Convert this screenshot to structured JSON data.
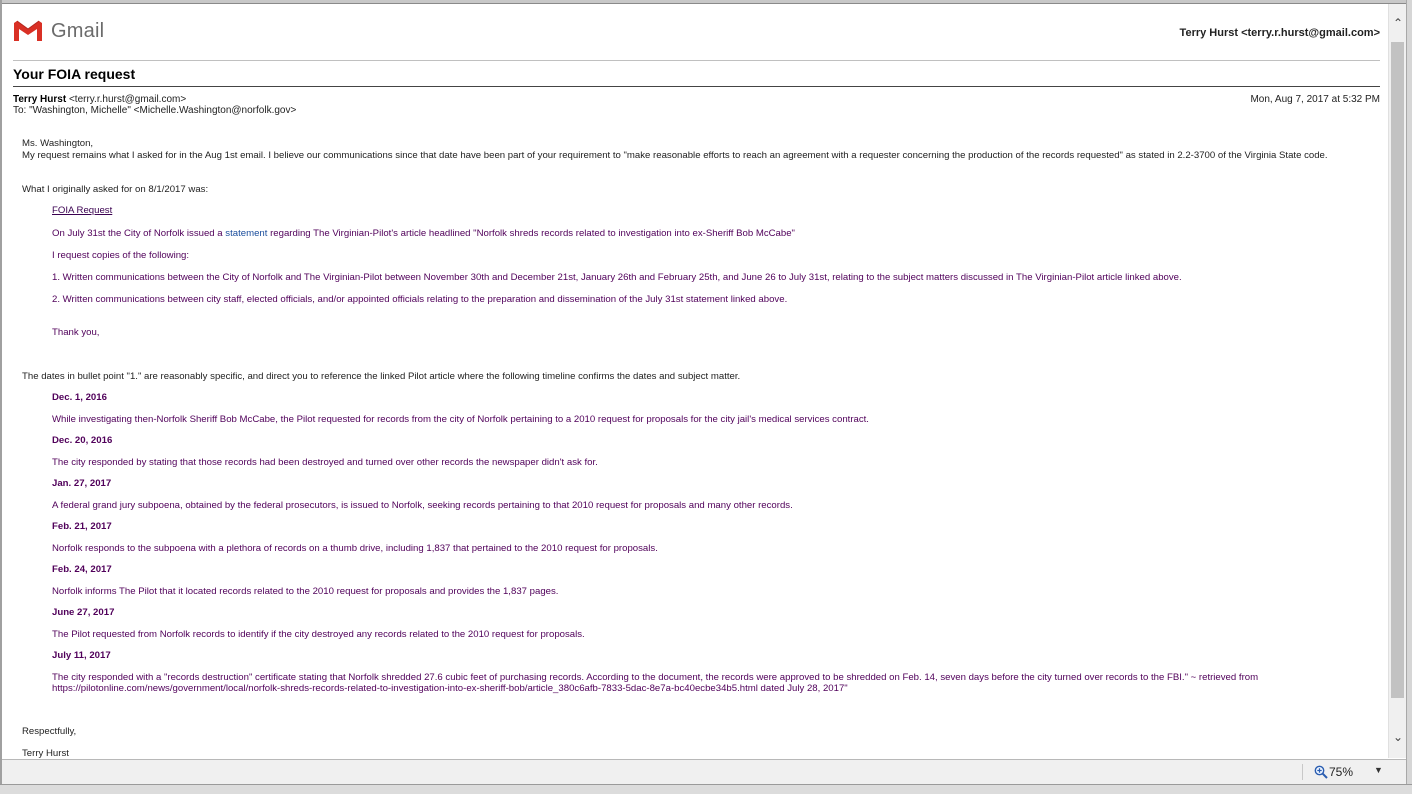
{
  "header": {
    "logo_text": "Gmail",
    "account": "Terry Hurst <terry.r.hurst@gmail.com>"
  },
  "email": {
    "subject": "Your FOIA request",
    "from_name": "Terry Hurst",
    "from_addr": "<terry.r.hurst@gmail.com>",
    "to": "To: \"Washington, Michelle\" <Michelle.Washington@norfolk.gov>",
    "date": "Mon, Aug 7, 2017 at 5:32 PM"
  },
  "body": {
    "greeting": "Ms. Washington,",
    "para1": "My request remains what I asked for in the Aug 1st email. I believe our communications since that date have been part of your requirement to \"make reasonable efforts to reach an agreement with a requester concerning the production of the records requested\" as stated in 2.2-3700 of the Virginia State code.",
    "para2": "What I originally asked for on 8/1/2017 was:",
    "foia_link": "FOIA Request",
    "july31_pre": "On July 31st the City of Norfolk issued a ",
    "statement_link": "statement",
    "july31_post": " regarding The Virginian-Pilot's article headlined \"Norfolk shreds records related to investigation into ex-Sheriff Bob McCabe\"",
    "request_copies": "I request copies of the following:",
    "item1": "1. Written communications between the City of Norfolk and The Virginian-Pilot between November 30th and December 21st, January 26th and February 25th, and June 26 to July 31st, relating to the subject matters discussed in The Virginian-Pilot article linked above.",
    "item2": "2. Written communications between city staff, elected officials, and/or appointed officials relating to the preparation and dissemination of the July 31st statement linked above.",
    "thank_you": "Thank you,",
    "dates_intro": "The dates in bullet point \"1.\" are reasonably specific, and direct you to reference the linked Pilot article where the following timeline confirms the dates and subject matter.",
    "timeline": [
      {
        "date": "Dec. 1, 2016",
        "text": "While investigating then-Norfolk Sheriff Bob McCabe, the Pilot requested for records from the city of Norfolk pertaining to a 2010 request for proposals for the city jail's medical services contract."
      },
      {
        "date": "Dec. 20, 2016",
        "text": "The city responded by stating that those records had been destroyed and turned over other records the newspaper didn't ask for."
      },
      {
        "date": "Jan. 27, 2017",
        "text": "A federal grand jury subpoena, obtained by the federal prosecutors, is issued to Norfolk, seeking records pertaining to that 2010 request for proposals and many other records."
      },
      {
        "date": "Feb. 21, 2017",
        "text": "Norfolk responds to the subpoena with a plethora of records on a thumb drive, including 1,837 that pertained to the 2010 request for proposals."
      },
      {
        "date": "Feb. 24, 2017",
        "text": "Norfolk informs The Pilot that it located records related to the 2010 request for proposals and provides the 1,837 pages."
      },
      {
        "date": "June 27, 2017",
        "text": "The Pilot requested from Norfolk records to identify if the city destroyed any records related to the 2010 request for proposals."
      },
      {
        "date": "July 11, 2017",
        "text": "The city responded with a \"records destruction\" certificate stating that Norfolk shredded 27.6 cubic feet of purchasing records. According to the document, the records were approved to be shredded on Feb. 14, seven days before the city turned over records to the FBI.\" ~ retrieved from https://pilotonline.com/news/government/local/norfolk-shreds-records-related-to-investigation-into-ex-sheriff-bob/article_380c6afb-7833-5dac-8e7a-bc40ecbe34b5.html dated July 28, 2017\""
      }
    ],
    "closing": "Respectfully,",
    "signature": "Terry Hurst"
  },
  "statusbar": {
    "zoom": "75%"
  }
}
